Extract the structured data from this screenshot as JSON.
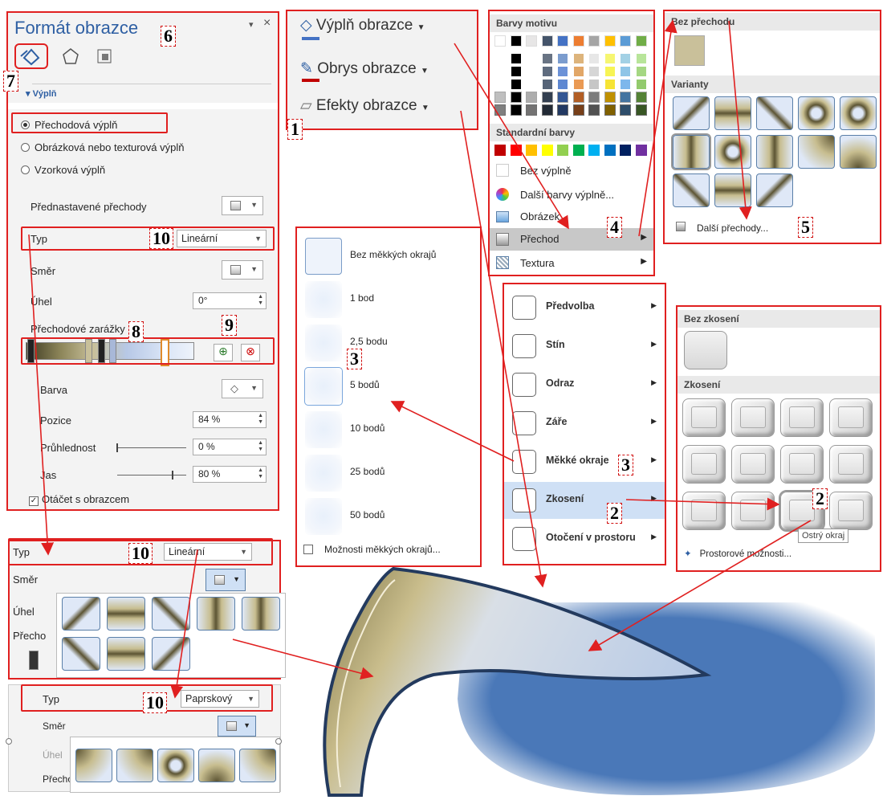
{
  "format_pane": {
    "title": "Formát obrazce",
    "section": "Výplň",
    "fill_options": [
      "Přechodová výplň",
      "Obrázková nebo texturová výplň",
      "Vzorková výplň"
    ],
    "preset_label": "Přednastavené přechody",
    "type_label": "Typ",
    "type_value": "Lineární",
    "direction_label": "Směr",
    "angle_label": "Úhel",
    "angle_value": "0°",
    "stops_label": "Přechodové zarážky",
    "color_label": "Barva",
    "position_label": "Pozice",
    "position_value": "84 %",
    "transparency_label": "Průhlednost",
    "transparency_value": "0 %",
    "brightness_label": "Jas",
    "brightness_value": "80 %",
    "rotate_label": "Otáčet s obrazcem"
  },
  "ribbon": {
    "fill": "Výplň obrazce",
    "outline": "Obrys obrazce",
    "effects": "Efekty obrazce"
  },
  "color_menu": {
    "theme_colors": "Barvy motivu",
    "standard_colors": "Standardní barvy",
    "no_fill": "Bez výplně",
    "more_colors": "Další barvy výplně...",
    "picture": "Obrázek...",
    "gradient": "Přechod",
    "texture": "Textura",
    "theme_palette": [
      "#ffffff",
      "#000000",
      "#e7e6e6",
      "#44546a",
      "#4472c4",
      "#ed7d31",
      "#a5a5a5",
      "#ffc000",
      "#5b9bd5",
      "#70ad47",
      "#ffffff",
      "#000000"
    ],
    "standard_palette": [
      "#c00000",
      "#ff0000",
      "#ffc000",
      "#ffff00",
      "#92d050",
      "#00b050",
      "#00b0f0",
      "#0070c0",
      "#002060",
      "#7030a0"
    ]
  },
  "gradient_menu": {
    "no_gradient": "Bez přechodu",
    "variants": "Varianty",
    "more": "Další přechody..."
  },
  "soft_edges": {
    "items": [
      "Bez měkkých okrajů",
      "1 bod",
      "2,5 bodu",
      "5 bodů",
      "10 bodů",
      "25 bodů",
      "50 bodů"
    ],
    "options": "Možnosti měkkých okrajů..."
  },
  "effects_menu": {
    "items": [
      "Předvolba",
      "Stín",
      "Odraz",
      "Záře",
      "Měkké okraje",
      "Zkosení",
      "Otočení v prostoru"
    ]
  },
  "bevel_menu": {
    "no_bevel": "Bez zkosení",
    "bevel": "Zkosení",
    "tooltip": "Ostrý okraj",
    "options": "Prostorové možnosti..."
  },
  "lower_panel_1": {
    "type_label": "Typ",
    "type_value": "Lineární",
    "direction_label": "Směr",
    "angle_label": "Úhel",
    "stops_label": "Přecho"
  },
  "lower_panel_2": {
    "type_label": "Typ",
    "type_value": "Paprskový",
    "direction_label": "Směr",
    "angle_label": "Úhel",
    "stops_label": "Přecho"
  },
  "callouts": {
    "n1": "1",
    "n2": "2",
    "n3": "3",
    "n4": "4",
    "n5": "5",
    "n6": "6",
    "n7": "7",
    "n8": "8",
    "n9": "9",
    "n10": "10"
  }
}
